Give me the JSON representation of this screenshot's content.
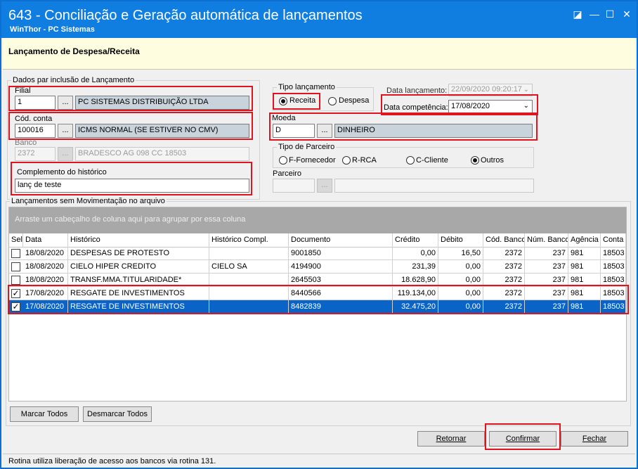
{
  "window": {
    "title": "643 - Conciliação e Geração automática de lançamentos",
    "subtitle": "WinThor - PC Sistemas",
    "controls": [
      "◪",
      "—",
      "☐",
      "✕"
    ]
  },
  "header": {
    "title": "Lançamento de Despesa/Receita"
  },
  "dados": {
    "group_label": "Dados par inclusão de Lançamento",
    "filial": {
      "label": "Filial",
      "code": "1",
      "name": "PC SISTEMAS DISTRIBUIÇÃO LTDA"
    },
    "cod_conta": {
      "label": "Cód. conta",
      "code": "100016",
      "name": "ICMS NORMAL (SE ESTIVER NO CMV)"
    },
    "banco": {
      "label": "Banco",
      "code": "2372",
      "name": "BRADESCO AG 098 CC 18503"
    },
    "complemento": {
      "label": "Complemento do histórico",
      "value": "lanç de teste"
    },
    "lookup_button": "..."
  },
  "tipo_lancamento": {
    "label": "Tipo lançamento",
    "options": [
      "Receita",
      "Despesa"
    ],
    "selected": "Receita"
  },
  "datas": {
    "lancamento_label": "Data lançamento:",
    "lancamento_value": "22/09/2020 09:20:17",
    "competencia_label": "Data competência:",
    "competencia_value": "17/08/2020"
  },
  "moeda": {
    "label": "Moeda",
    "code": "D",
    "name": "DINHEIRO"
  },
  "tipo_parceiro": {
    "label": "Tipo de Parceiro",
    "options": [
      "F-Fornecedor",
      "R-RCA",
      "C-Cliente",
      "Outros"
    ],
    "selected": "Outros"
  },
  "parceiro": {
    "label": "Parceiro"
  },
  "grid": {
    "group_label": "Lançamentos sem Movimentação no arquivo",
    "drag_hint": "Arraste um cabeçalho de coluna aqui para agrupar por essa coluna",
    "columns": [
      "Sel",
      "Data",
      "Histórico",
      "Histórico Compl.",
      "Documento",
      "Crédito",
      "Débito",
      "Cód. Banco",
      "Núm. Banco",
      "Agência",
      "Conta"
    ],
    "rows": [
      {
        "checked": false,
        "data": "18/08/2020",
        "historico": "DESPESAS DE PROTESTO",
        "compl": "",
        "documento": "9001850",
        "credito": "0,00",
        "debito": "16,50",
        "cod_banco": "2372",
        "num_banco": "237",
        "agencia": "981",
        "conta": "18503"
      },
      {
        "checked": false,
        "data": "18/08/2020",
        "historico": "CIELO HIPER CREDITO",
        "compl": "CIELO SA",
        "documento": "4194900",
        "credito": "231,39",
        "debito": "0,00",
        "cod_banco": "2372",
        "num_banco": "237",
        "agencia": "981",
        "conta": "18503"
      },
      {
        "checked": false,
        "data": "18/08/2020",
        "historico": "TRANSF.MMA.TITULARIDADE*",
        "compl": "",
        "documento": "2645503",
        "credito": "18.628,90",
        "debito": "0,00",
        "cod_banco": "2372",
        "num_banco": "237",
        "agencia": "981",
        "conta": "18503"
      },
      {
        "checked": true,
        "data": "17/08/2020",
        "historico": "RESGATE DE INVESTIMENTOS",
        "compl": "",
        "documento": "8440566",
        "credito": "119.134,00",
        "debito": "0,00",
        "cod_banco": "2372",
        "num_banco": "237",
        "agencia": "981",
        "conta": "18503"
      },
      {
        "checked": true,
        "data": "17/08/2020",
        "historico": "RESGATE DE INVESTIMENTOS",
        "compl": "",
        "documento": "8482839",
        "credito": "32.475,20",
        "debito": "0,00",
        "cod_banco": "2372",
        "num_banco": "237",
        "agencia": "981",
        "conta": "18503"
      }
    ]
  },
  "buttons": {
    "marcar_todos": "Marcar Todos",
    "desmarcar_todos": "Desmarcar Todos",
    "retornar": "Retornar",
    "confirmar": "Confirmar",
    "fechar": "Fechar"
  },
  "status": "Rotina utiliza liberação de acesso aos bancos via rotina 131.",
  "colors": {
    "title_bar": "#0f7ee0",
    "highlight": "#e0141e",
    "selected_row": "#0a64c8",
    "header_band": "#fffde0"
  }
}
